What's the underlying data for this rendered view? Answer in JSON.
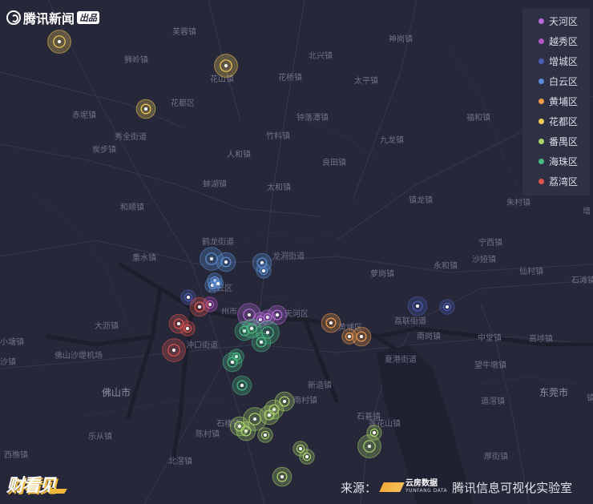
{
  "brand": {
    "name": "腾讯新闻",
    "tag": "出品"
  },
  "legend": {
    "items": [
      {
        "label": "天河区",
        "color": "#b76bd9"
      },
      {
        "label": "越秀区",
        "color": "#b056c7"
      },
      {
        "label": "增城区",
        "color": "#4d5bb5"
      },
      {
        "label": "白云区",
        "color": "#5b8ed6"
      },
      {
        "label": "黄埔区",
        "color": "#ee9a4b"
      },
      {
        "label": "花都区",
        "color": "#f3cc55"
      },
      {
        "label": "番禺区",
        "color": "#a9d56a"
      },
      {
        "label": "海珠区",
        "color": "#48bb82"
      },
      {
        "label": "荔湾区",
        "color": "#e0534f"
      }
    ]
  },
  "map_labels": {
    "towns": [
      "芙蓉镇",
      "神岗镇",
      "狮岭镇",
      "北兴镇",
      "花山镇",
      "花桥镇",
      "太平镇",
      "花都区",
      "赤坭镇",
      "钟落潭镇",
      "福和镇",
      "秀全街道",
      "竹料镇",
      "炭步镇",
      "九龙镇",
      "人和镇",
      "良田镇",
      "蚌湖镇",
      "太和镇",
      "和顺镇",
      "镇龙镇",
      "朱村镇",
      "增",
      "鹤龙街道",
      "宁西镇",
      "龙洞街道",
      "永和镇",
      "重水镇",
      "沙娅镇",
      "仙村镇",
      "白云区",
      "萝岗镇",
      "石滩镇",
      "州市",
      "天河区",
      "大沥镇",
      "黄埔区",
      "荔联街道",
      "小塘镇",
      "沖口街道",
      "佛山沙堤机场",
      "南岗镇",
      "中堂镇",
      "高埗镇",
      "夏港街道",
      "望牛墩镇",
      "新造镇",
      "南村镇",
      "道滘镇",
      "石楼镇",
      "石碁镇",
      "陈村镇",
      "乐从镇",
      "莲花山镇",
      "北滘镇",
      "西樵镇",
      "厚街镇",
      "镇",
      "沙镇"
    ],
    "cities": [
      "佛山市",
      "东莞市"
    ]
  },
  "source": {
    "prefix": "来源：",
    "partner_cn": "云房数据",
    "partner_en": "YUNFANG DATA",
    "suffix": "腾讯信息可视化实验室"
  },
  "bottom_logo": {
    "text": "财看见"
  },
  "markers": {
    "天河区": [
      4,
      2,
      2,
      3
    ],
    "越秀区": [
      2
    ],
    "增城区": [
      2,
      3,
      2
    ],
    "白云区": [
      4,
      3,
      3,
      2,
      2,
      2,
      1
    ],
    "黄埔区": [
      3,
      2,
      3
    ],
    "花都区": [
      4,
      4,
      3
    ],
    "番禺区": [
      3,
      3,
      3,
      4,
      3,
      2,
      3,
      2,
      2,
      4,
      2,
      3
    ],
    "海珠区": [
      3,
      3,
      4,
      3,
      2,
      3,
      3
    ],
    "荔湾区": [
      3,
      2,
      3,
      4
    ]
  }
}
